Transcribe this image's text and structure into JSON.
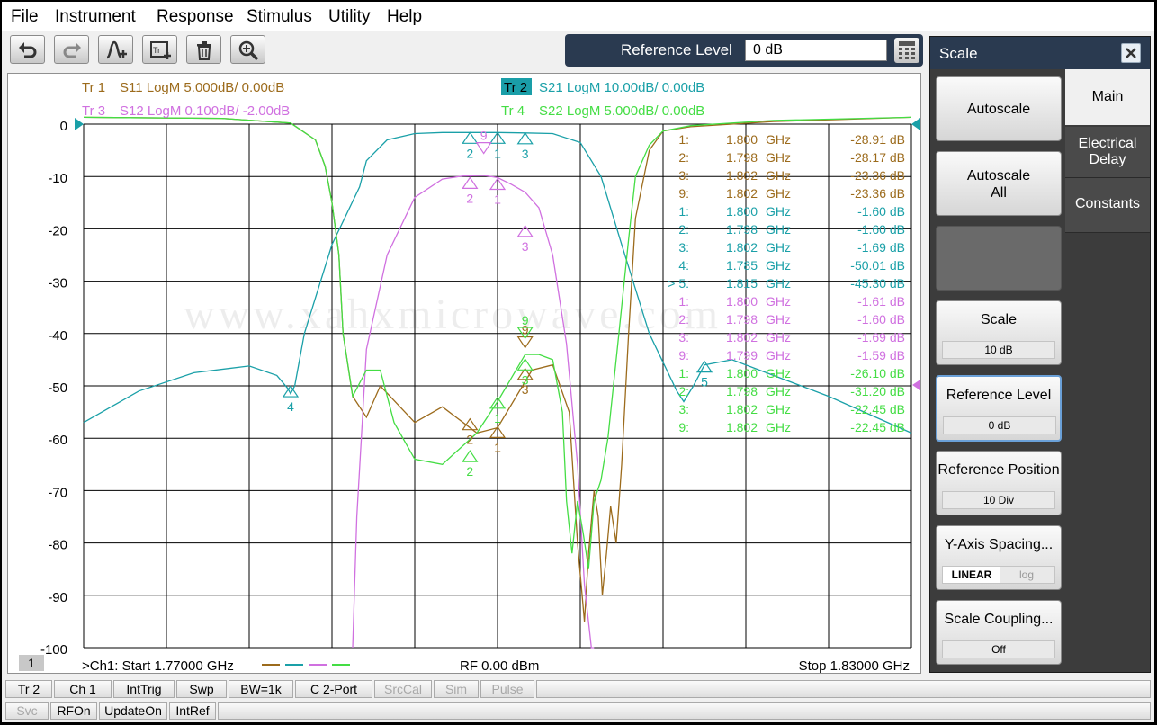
{
  "menu": [
    "File",
    "Instrument",
    "Response",
    "Stimulus",
    "Utility",
    "Help"
  ],
  "toolbar": {
    "buttons": [
      "undo-icon",
      "redo-icon",
      "add-marker-icon",
      "add-trace-icon",
      "delete-icon",
      "zoom-icon"
    ],
    "ref_level_label": "Reference Level",
    "ref_level_value": "0 dB"
  },
  "traces": [
    {
      "id": "Tr 1",
      "label": "S11 LogM 5.000dB/  0.00dB",
      "color": "#9c6b1c"
    },
    {
      "id": "Tr 2",
      "label": "S21 LogM 10.00dB/  0.00dB",
      "color": "#1aa0a8",
      "active": true
    },
    {
      "id": "Tr 3",
      "label": "S12 LogM 0.100dB/  -2.00dB",
      "color": "#d070e0"
    },
    {
      "id": "Tr 4",
      "label": "S22 LogM 5.000dB/  0.00dB",
      "color": "#44dd44"
    }
  ],
  "chart_data": {
    "type": "line",
    "xlim": [
      1.77,
      1.83
    ],
    "ylim": [
      -100,
      0
    ],
    "y_ticks": [
      "0",
      "-10",
      "-20",
      "-30",
      "-40",
      "-50",
      "-60",
      "-70",
      "-80",
      "-90",
      "-100"
    ],
    "grid": true,
    "series": [
      {
        "name": "S21",
        "color": "#1aa0a8",
        "x": [
          1.77,
          1.774,
          1.778,
          1.782,
          1.784,
          1.7848,
          1.785,
          1.7853,
          1.786,
          1.788,
          1.79,
          1.7905,
          1.792,
          1.794,
          1.796,
          1.798,
          1.8,
          1.802,
          1.804,
          1.806,
          1.8075,
          1.809,
          1.811,
          1.813,
          1.8135,
          1.8142,
          1.815,
          1.817,
          1.82,
          1.824,
          1.83
        ],
        "y": [
          -57,
          -51,
          -47.5,
          -46.2,
          -48,
          -50.5,
          -51.5,
          -50,
          -40,
          -23,
          -12,
          -7,
          -3,
          -1.8,
          -1.6,
          -1.6,
          -1.6,
          -1.69,
          -1.8,
          -3.5,
          -10,
          -23,
          -40,
          -51,
          -53,
          -50,
          -46,
          -45,
          -48,
          -52,
          -59
        ]
      },
      {
        "name": "S11",
        "color": "#9c6b1c",
        "x": [
          1.77,
          1.78,
          1.785,
          1.7868,
          1.7875,
          1.788,
          1.7885,
          1.7888,
          1.7895,
          1.7905,
          1.7915,
          1.794,
          1.796,
          1.7975,
          1.7985,
          1.8,
          1.8025,
          1.804,
          1.8052,
          1.8058,
          1.8063,
          1.8066,
          1.807,
          1.8073,
          1.8076,
          1.8079,
          1.8082,
          1.8086,
          1.809,
          1.8095,
          1.81,
          1.811,
          1.812,
          1.814,
          1.82,
          1.83
        ],
        "y": [
          1.3,
          1.1,
          0.2,
          -3,
          -8,
          -15,
          -25,
          -40,
          -52,
          -56,
          -50,
          -57,
          -54,
          -57,
          -59,
          -58,
          -47,
          -46,
          -55,
          -80,
          -95,
          -82,
          -70,
          -75,
          -90,
          -82,
          -73,
          -80,
          -65,
          -40,
          -18,
          -5,
          -1.3,
          -0.5,
          0.5,
          1.3
        ]
      },
      {
        "name": "S12",
        "color": "#d070e0",
        "x": [
          1.7895,
          1.7898,
          1.7905,
          1.792,
          1.794,
          1.796,
          1.7975,
          1.799,
          1.8,
          1.801,
          1.802,
          1.803,
          1.804,
          1.805,
          1.8058,
          1.8063,
          1.8068,
          1.807
        ],
        "y": [
          -100,
          -75,
          -43,
          -25,
          -14,
          -10.5,
          -9.9,
          -9.8,
          -10.2,
          -11.5,
          -13,
          -16,
          -25,
          -42,
          -65,
          -88,
          -100,
          -100
        ]
      },
      {
        "name": "S22",
        "color": "#44dd44",
        "x": [
          1.77,
          1.78,
          1.785,
          1.7868,
          1.7875,
          1.788,
          1.7885,
          1.7888,
          1.7895,
          1.7905,
          1.7915,
          1.7925,
          1.794,
          1.796,
          1.7985,
          1.8,
          1.802,
          1.803,
          1.804,
          1.8047,
          1.805,
          1.8054,
          1.8058,
          1.8062,
          1.8066,
          1.807,
          1.8075,
          1.808,
          1.8088,
          1.8095,
          1.81,
          1.811,
          1.812,
          1.814,
          1.82,
          1.83
        ],
        "y": [
          1.3,
          1.1,
          0.2,
          -3,
          -8,
          -15,
          -25,
          -40,
          -52,
          -47,
          -47,
          -57,
          -64,
          -65,
          -59,
          -53,
          -44,
          -44,
          -45,
          -55,
          -72,
          -82,
          -72,
          -78,
          -85,
          -72,
          -68,
          -60,
          -40,
          -22,
          -10,
          -4,
          -1.3,
          -0.3,
          0.7,
          1.3
        ]
      }
    ],
    "markers": [
      {
        "series": "S21",
        "label": "1",
        "x": 1.8,
        "y": -1.6
      },
      {
        "series": "S21",
        "label": "2",
        "x": 1.798,
        "y": -1.6
      },
      {
        "series": "S21",
        "label": "3",
        "x": 1.802,
        "y": -1.69
      },
      {
        "series": "S21",
        "label": "4",
        "x": 1.785,
        "y": -50.01
      },
      {
        "series": "S21",
        "label": "5",
        "x": 1.815,
        "y": -45.3
      },
      {
        "series": "S12",
        "label": "1",
        "x": 1.8,
        "y": -10.4
      },
      {
        "series": "S12",
        "label": "2",
        "x": 1.798,
        "y": -10.2
      },
      {
        "series": "S12",
        "label": "3",
        "x": 1.802,
        "y": -19.4
      },
      {
        "series": "S12",
        "label": "9",
        "x": 1.799,
        "y": -5.6
      },
      {
        "series": "S11",
        "label": "1",
        "x": 1.8,
        "y": -57.8
      },
      {
        "series": "S11",
        "label": "2",
        "x": 1.798,
        "y": -56.3
      },
      {
        "series": "S11",
        "label": "3",
        "x": 1.802,
        "y": -46.7
      },
      {
        "series": "S11",
        "label": "9",
        "x": 1.802,
        "y": -42.7
      },
      {
        "series": "S22",
        "label": "1",
        "x": 1.8,
        "y": -52.2
      },
      {
        "series": "S22",
        "label": "2",
        "x": 1.798,
        "y": -62.4
      },
      {
        "series": "S22",
        "label": "3",
        "x": 1.802,
        "y": -44.9
      },
      {
        "series": "S22",
        "label": "9",
        "x": 1.802,
        "y": -40.9
      }
    ]
  },
  "marker_table": [
    {
      "id": "1:",
      "freq": "1.800",
      "unit": "GHz",
      "val": "-28.91 dB",
      "color": "#9c6b1c"
    },
    {
      "id": "2:",
      "freq": "1.798",
      "unit": "GHz",
      "val": "-28.17 dB",
      "color": "#9c6b1c"
    },
    {
      "id": "3:",
      "freq": "1.802",
      "unit": "GHz",
      "val": "-23.36 dB",
      "color": "#9c6b1c"
    },
    {
      "id": "9:",
      "freq": "1.802",
      "unit": "GHz",
      "val": "-23.36 dB",
      "color": "#9c6b1c"
    },
    {
      "id": "1:",
      "freq": "1.800",
      "unit": "GHz",
      "val": "-1.60 dB",
      "color": "#1aa0a8"
    },
    {
      "id": "2:",
      "freq": "1.798",
      "unit": "GHz",
      "val": "-1.60 dB",
      "color": "#1aa0a8"
    },
    {
      "id": "3:",
      "freq": "1.802",
      "unit": "GHz",
      "val": "-1.69 dB",
      "color": "#1aa0a8"
    },
    {
      "id": "4:",
      "freq": "1.785",
      "unit": "GHz",
      "val": "-50.01 dB",
      "color": "#1aa0a8"
    },
    {
      "id": "> 5:",
      "freq": "1.815",
      "unit": "GHz",
      "val": "-45.30 dB",
      "color": "#1aa0a8"
    },
    {
      "id": "1:",
      "freq": "1.800",
      "unit": "GHz",
      "val": "-1.61 dB",
      "color": "#d070e0"
    },
    {
      "id": "2:",
      "freq": "1.798",
      "unit": "GHz",
      "val": "-1.60 dB",
      "color": "#d070e0"
    },
    {
      "id": "3:",
      "freq": "1.802",
      "unit": "GHz",
      "val": "-1.69 dB",
      "color": "#d070e0"
    },
    {
      "id": "9:",
      "freq": "1.799",
      "unit": "GHz",
      "val": "-1.59 dB",
      "color": "#d070e0"
    },
    {
      "id": "1:",
      "freq": "1.800",
      "unit": "GHz",
      "val": "-26.10 dB",
      "color": "#44dd44"
    },
    {
      "id": "2:",
      "freq": "1.798",
      "unit": "GHz",
      "val": "-31.20 dB",
      "color": "#44dd44"
    },
    {
      "id": "3:",
      "freq": "1.802",
      "unit": "GHz",
      "val": "-22.45 dB",
      "color": "#44dd44"
    },
    {
      "id": "9:",
      "freq": "1.802",
      "unit": "GHz",
      "val": "-22.45 dB",
      "color": "#44dd44"
    }
  ],
  "footer": {
    "channel_badge": "1",
    "start": ">Ch1:  Start   1.77000 GHz",
    "rf": "RF     0.00 dBm",
    "stop": "Stop  1.83000 GHz"
  },
  "watermark": "www.xahxmicrowave.com",
  "panel": {
    "title": "Scale",
    "autoscale": "Autoscale",
    "autoscale_all_1": "Autoscale",
    "autoscale_all_2": "All",
    "scale_label": "Scale",
    "scale_value": "10 dB",
    "ref_level_label": "Reference Level",
    "ref_level_value": "0 dB",
    "ref_pos_label": "Reference Position",
    "ref_pos_value": "10 Div",
    "y_spacing_label": "Y-Axis Spacing...",
    "y_spacing_linear": "LINEAR",
    "y_spacing_log": "log",
    "coupling_label": "Scale Coupling...",
    "coupling_value": "Off",
    "tabs": {
      "main": "Main",
      "elec1": "Electrical",
      "elec2": "Delay",
      "constants": "Constants"
    }
  },
  "status_row1": [
    {
      "label": "Tr 2",
      "enabled": true
    },
    {
      "label": "Ch 1",
      "enabled": true
    },
    {
      "label": "IntTrig",
      "enabled": true
    },
    {
      "label": "Swp",
      "enabled": true
    },
    {
      "label": "BW=1k",
      "enabled": true
    },
    {
      "label": "C  2-Port",
      "enabled": true
    },
    {
      "label": "SrcCal",
      "enabled": false
    },
    {
      "label": "Sim",
      "enabled": false
    },
    {
      "label": "Pulse",
      "enabled": false
    }
  ],
  "status_row2": [
    {
      "label": "Svc",
      "enabled": false
    },
    {
      "label": "RFOn",
      "enabled": true
    },
    {
      "label": "UpdateOn",
      "enabled": true
    },
    {
      "label": "IntRef",
      "enabled": true
    }
  ]
}
